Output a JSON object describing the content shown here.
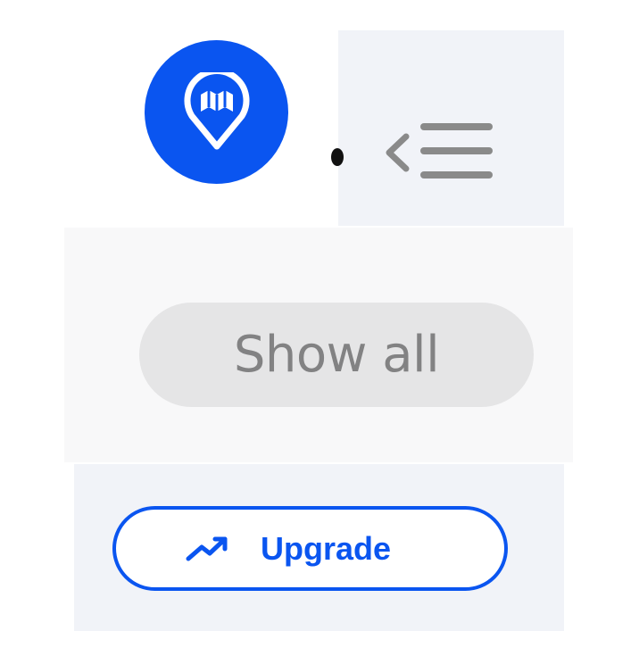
{
  "sidebar": {
    "logo": {
      "icon": "map-pin-icon",
      "color": "#0a55f0"
    },
    "collapse_icon": "collapse-menu-icon",
    "show_all_label": "Show all",
    "upgrade": {
      "label": "Upgrade",
      "icon": "trending-up-icon",
      "color": "#0a55f0"
    }
  }
}
